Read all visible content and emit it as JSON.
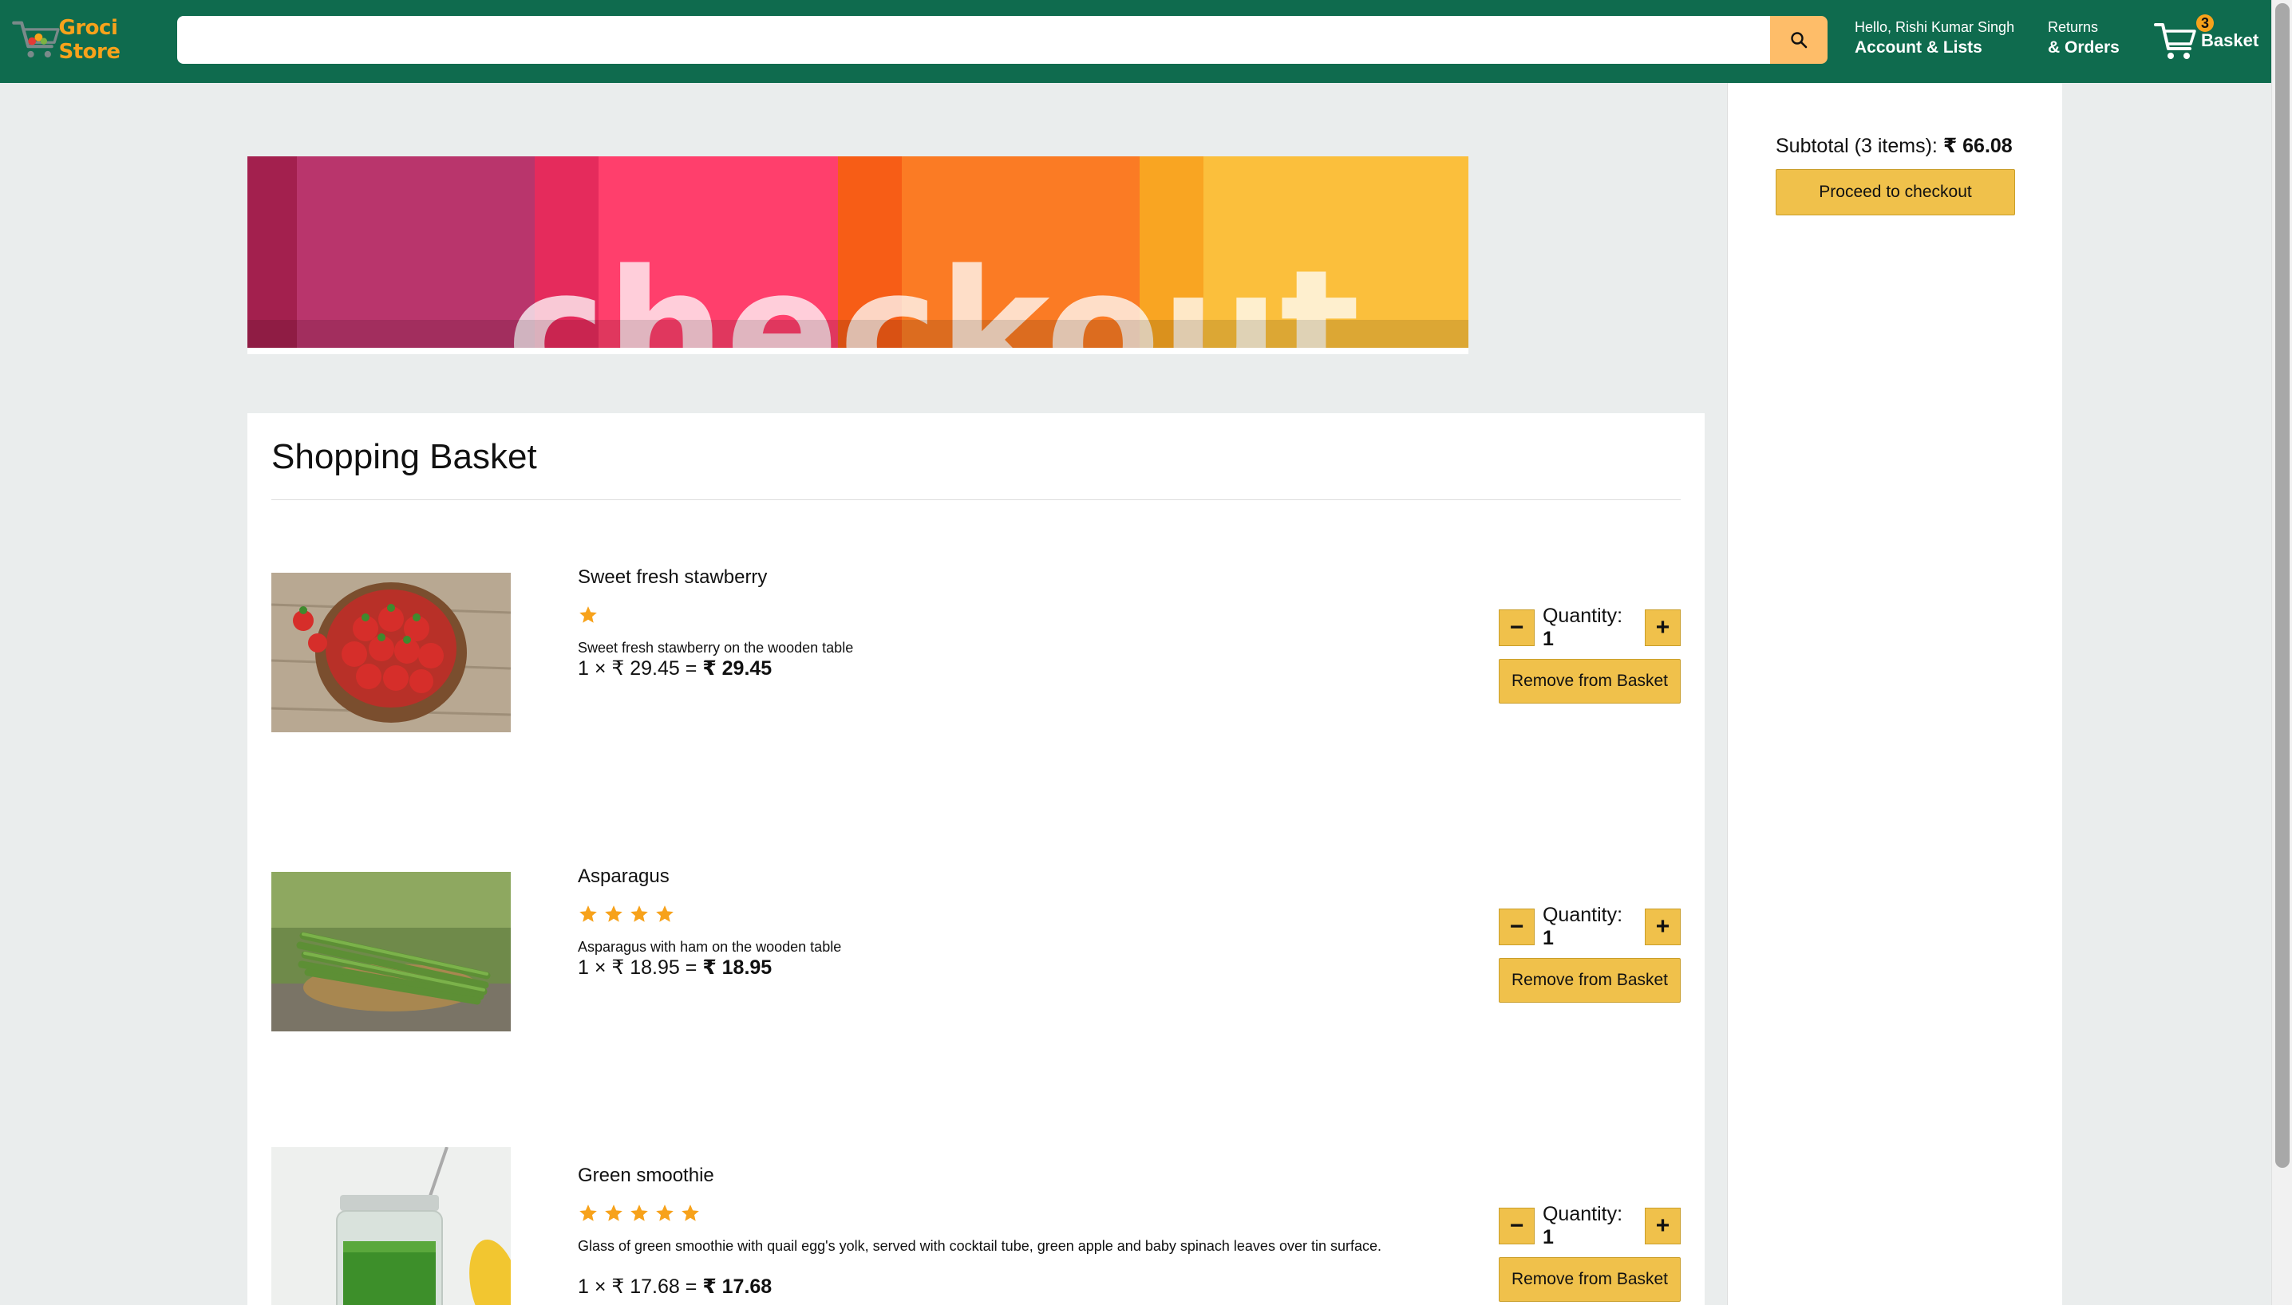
{
  "header": {
    "logo_text": "Groci Store",
    "search_placeholder": "",
    "account_line1": "Hello, Rishi Kumar Singh",
    "account_line2": "Account & Lists",
    "orders_line1": "Returns",
    "orders_line2": "& Orders",
    "basket_count": "3",
    "basket_label": "Basket"
  },
  "banner": {
    "text": "checkout"
  },
  "basket": {
    "title": "Shopping Basket",
    "items": [
      {
        "title": "Sweet fresh stawberry",
        "rating": 1,
        "description": "Sweet fresh stawberry on the wooden table",
        "price_expr": "1 × ₹ 29.45 = ",
        "price_total": "₹ 29.45",
        "quantity_label": "Quantity: ",
        "quantity": "1",
        "remove_label": "Remove from Basket"
      },
      {
        "title": "Asparagus",
        "rating": 4,
        "description": "Asparagus with ham on the wooden table",
        "price_expr": "1 × ₹ 18.95 = ",
        "price_total": "₹ 18.95",
        "quantity_label": "Quantity: ",
        "quantity": "1",
        "remove_label": "Remove from Basket"
      },
      {
        "title": "Green smoothie",
        "rating": 5,
        "description": "Glass of green smoothie with quail egg's yolk, served with cocktail tube, green apple and baby spinach leaves over tin surface.",
        "price_expr": "1 × ₹ 17.68 = ",
        "price_total": "₹ 17.68",
        "quantity_label": "Quantity: ",
        "quantity": "1",
        "remove_label": "Remove from Basket"
      }
    ]
  },
  "subtotal": {
    "label": "Subtotal (3 items): ",
    "amount": "₹ 66.08",
    "checkout_label": "Proceed to checkout"
  },
  "colors": {
    "header_bg": "#0f6b4e",
    "accent": "#f0c14b",
    "star": "#f7a21b",
    "logo": "#f7a21b"
  },
  "icons": {
    "logo": "cart-logo-icon",
    "search": "search-icon",
    "basket": "shopping-cart-icon",
    "star": "star-icon",
    "minus": "minus-icon",
    "plus": "plus-icon"
  }
}
